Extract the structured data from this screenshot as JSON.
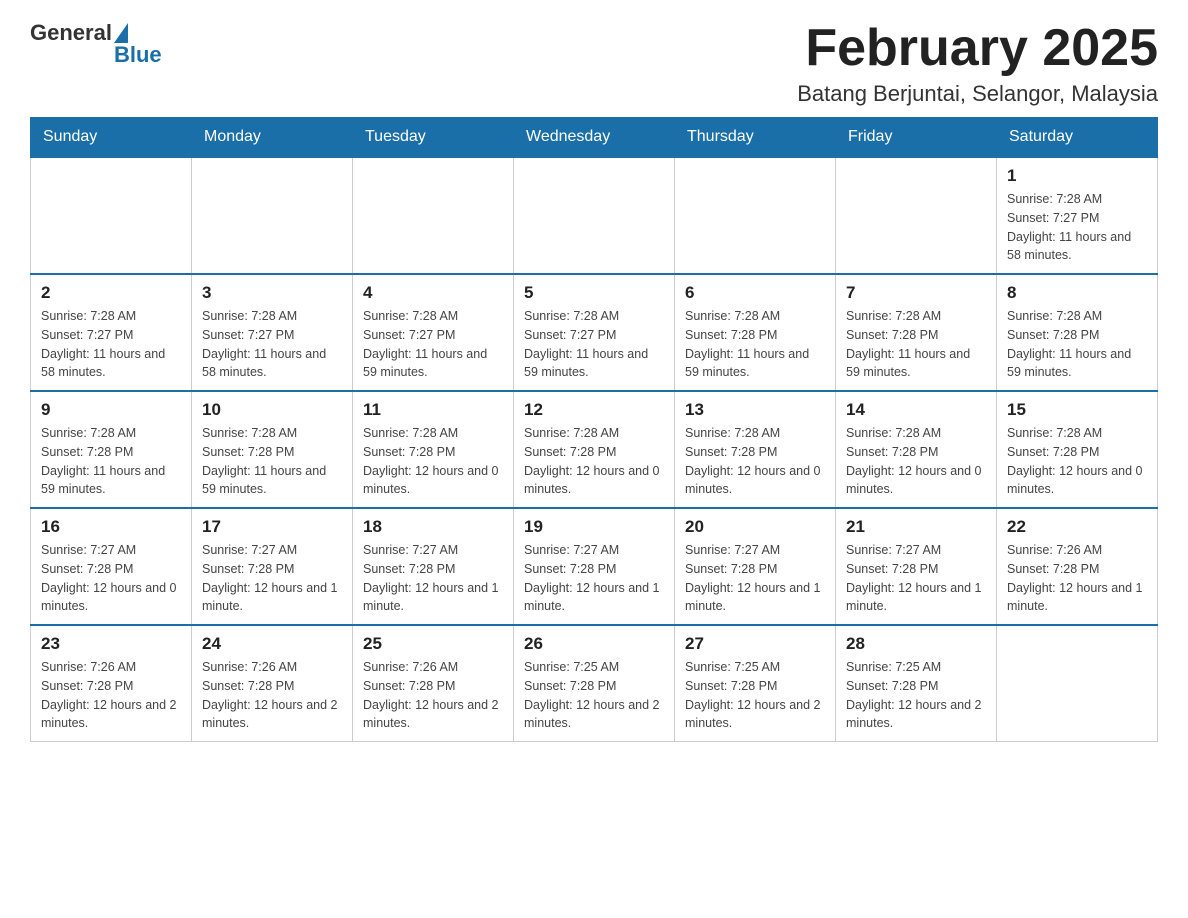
{
  "header": {
    "logo_general": "General",
    "logo_blue": "Blue",
    "month_title": "February 2025",
    "location": "Batang Berjuntai, Selangor, Malaysia"
  },
  "days_of_week": [
    "Sunday",
    "Monday",
    "Tuesday",
    "Wednesday",
    "Thursday",
    "Friday",
    "Saturday"
  ],
  "weeks": [
    {
      "days": [
        {
          "number": "",
          "empty": true
        },
        {
          "number": "",
          "empty": true
        },
        {
          "number": "",
          "empty": true
        },
        {
          "number": "",
          "empty": true
        },
        {
          "number": "",
          "empty": true
        },
        {
          "number": "",
          "empty": true
        },
        {
          "number": "1",
          "sunrise": "Sunrise: 7:28 AM",
          "sunset": "Sunset: 7:27 PM",
          "daylight": "Daylight: 11 hours and 58 minutes."
        }
      ]
    },
    {
      "days": [
        {
          "number": "2",
          "sunrise": "Sunrise: 7:28 AM",
          "sunset": "Sunset: 7:27 PM",
          "daylight": "Daylight: 11 hours and 58 minutes."
        },
        {
          "number": "3",
          "sunrise": "Sunrise: 7:28 AM",
          "sunset": "Sunset: 7:27 PM",
          "daylight": "Daylight: 11 hours and 58 minutes."
        },
        {
          "number": "4",
          "sunrise": "Sunrise: 7:28 AM",
          "sunset": "Sunset: 7:27 PM",
          "daylight": "Daylight: 11 hours and 59 minutes."
        },
        {
          "number": "5",
          "sunrise": "Sunrise: 7:28 AM",
          "sunset": "Sunset: 7:27 PM",
          "daylight": "Daylight: 11 hours and 59 minutes."
        },
        {
          "number": "6",
          "sunrise": "Sunrise: 7:28 AM",
          "sunset": "Sunset: 7:28 PM",
          "daylight": "Daylight: 11 hours and 59 minutes."
        },
        {
          "number": "7",
          "sunrise": "Sunrise: 7:28 AM",
          "sunset": "Sunset: 7:28 PM",
          "daylight": "Daylight: 11 hours and 59 minutes."
        },
        {
          "number": "8",
          "sunrise": "Sunrise: 7:28 AM",
          "sunset": "Sunset: 7:28 PM",
          "daylight": "Daylight: 11 hours and 59 minutes."
        }
      ]
    },
    {
      "days": [
        {
          "number": "9",
          "sunrise": "Sunrise: 7:28 AM",
          "sunset": "Sunset: 7:28 PM",
          "daylight": "Daylight: 11 hours and 59 minutes."
        },
        {
          "number": "10",
          "sunrise": "Sunrise: 7:28 AM",
          "sunset": "Sunset: 7:28 PM",
          "daylight": "Daylight: 11 hours and 59 minutes."
        },
        {
          "number": "11",
          "sunrise": "Sunrise: 7:28 AM",
          "sunset": "Sunset: 7:28 PM",
          "daylight": "Daylight: 12 hours and 0 minutes."
        },
        {
          "number": "12",
          "sunrise": "Sunrise: 7:28 AM",
          "sunset": "Sunset: 7:28 PM",
          "daylight": "Daylight: 12 hours and 0 minutes."
        },
        {
          "number": "13",
          "sunrise": "Sunrise: 7:28 AM",
          "sunset": "Sunset: 7:28 PM",
          "daylight": "Daylight: 12 hours and 0 minutes."
        },
        {
          "number": "14",
          "sunrise": "Sunrise: 7:28 AM",
          "sunset": "Sunset: 7:28 PM",
          "daylight": "Daylight: 12 hours and 0 minutes."
        },
        {
          "number": "15",
          "sunrise": "Sunrise: 7:28 AM",
          "sunset": "Sunset: 7:28 PM",
          "daylight": "Daylight: 12 hours and 0 minutes."
        }
      ]
    },
    {
      "days": [
        {
          "number": "16",
          "sunrise": "Sunrise: 7:27 AM",
          "sunset": "Sunset: 7:28 PM",
          "daylight": "Daylight: 12 hours and 0 minutes."
        },
        {
          "number": "17",
          "sunrise": "Sunrise: 7:27 AM",
          "sunset": "Sunset: 7:28 PM",
          "daylight": "Daylight: 12 hours and 1 minute."
        },
        {
          "number": "18",
          "sunrise": "Sunrise: 7:27 AM",
          "sunset": "Sunset: 7:28 PM",
          "daylight": "Daylight: 12 hours and 1 minute."
        },
        {
          "number": "19",
          "sunrise": "Sunrise: 7:27 AM",
          "sunset": "Sunset: 7:28 PM",
          "daylight": "Daylight: 12 hours and 1 minute."
        },
        {
          "number": "20",
          "sunrise": "Sunrise: 7:27 AM",
          "sunset": "Sunset: 7:28 PM",
          "daylight": "Daylight: 12 hours and 1 minute."
        },
        {
          "number": "21",
          "sunrise": "Sunrise: 7:27 AM",
          "sunset": "Sunset: 7:28 PM",
          "daylight": "Daylight: 12 hours and 1 minute."
        },
        {
          "number": "22",
          "sunrise": "Sunrise: 7:26 AM",
          "sunset": "Sunset: 7:28 PM",
          "daylight": "Daylight: 12 hours and 1 minute."
        }
      ]
    },
    {
      "days": [
        {
          "number": "23",
          "sunrise": "Sunrise: 7:26 AM",
          "sunset": "Sunset: 7:28 PM",
          "daylight": "Daylight: 12 hours and 2 minutes."
        },
        {
          "number": "24",
          "sunrise": "Sunrise: 7:26 AM",
          "sunset": "Sunset: 7:28 PM",
          "daylight": "Daylight: 12 hours and 2 minutes."
        },
        {
          "number": "25",
          "sunrise": "Sunrise: 7:26 AM",
          "sunset": "Sunset: 7:28 PM",
          "daylight": "Daylight: 12 hours and 2 minutes."
        },
        {
          "number": "26",
          "sunrise": "Sunrise: 7:25 AM",
          "sunset": "Sunset: 7:28 PM",
          "daylight": "Daylight: 12 hours and 2 minutes."
        },
        {
          "number": "27",
          "sunrise": "Sunrise: 7:25 AM",
          "sunset": "Sunset: 7:28 PM",
          "daylight": "Daylight: 12 hours and 2 minutes."
        },
        {
          "number": "28",
          "sunrise": "Sunrise: 7:25 AM",
          "sunset": "Sunset: 7:28 PM",
          "daylight": "Daylight: 12 hours and 2 minutes."
        },
        {
          "number": "",
          "empty": true
        }
      ]
    }
  ]
}
